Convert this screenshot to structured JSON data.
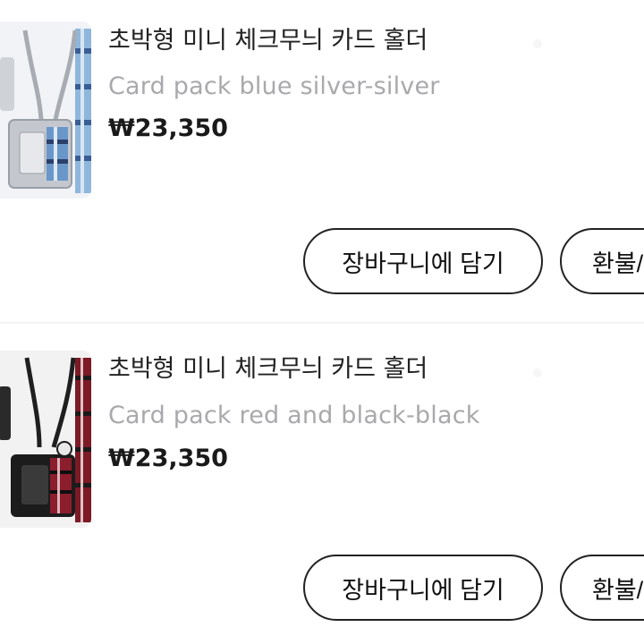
{
  "orders": [
    {
      "product_name": "초박형 미니 체크무늬 카드 홀더",
      "option": "Card pack blue silver-silver",
      "price": "₩23,350",
      "thumbnail_icon": "card-holder-blue-silver-image",
      "accent_colors": [
        "#c9cdd3",
        "#6fa8d8",
        "#2b3f6b"
      ],
      "buttons": {
        "add_to_cart": "장바구니에 담기",
        "refund": "환불/"
      }
    },
    {
      "product_name": "초박형 미니 체크무늬 카드 홀더",
      "option": "Card pack red and black-black",
      "price": "₩23,350",
      "thumbnail_icon": "card-holder-red-black-image",
      "accent_colors": [
        "#1b1b1b",
        "#8c1d2c",
        "#d8d8d8"
      ],
      "buttons": {
        "add_to_cart": "장바구니에 담기",
        "refund": "환불/"
      }
    }
  ]
}
